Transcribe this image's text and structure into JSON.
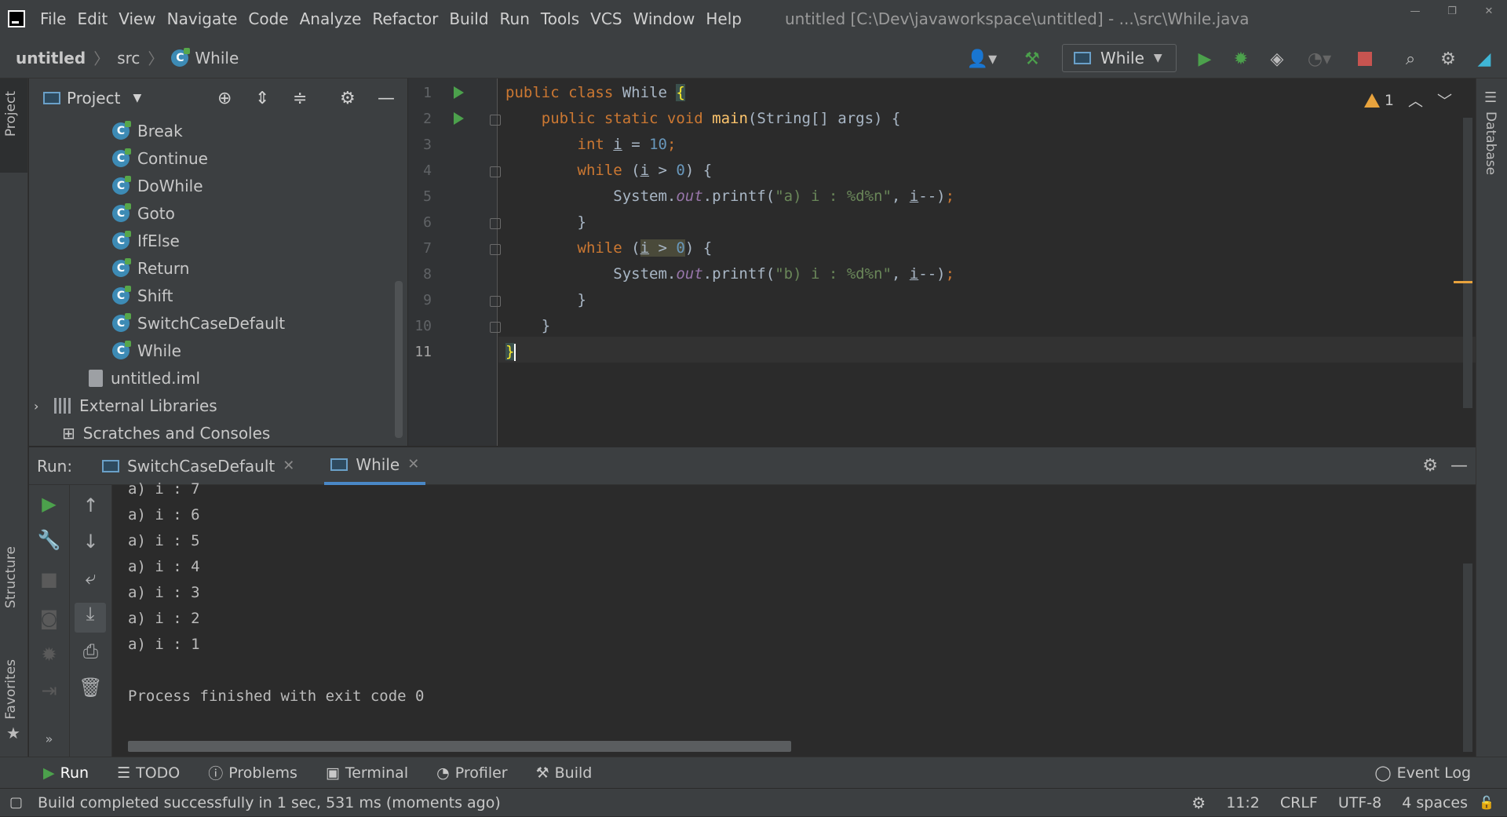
{
  "menubar": {
    "items": [
      "File",
      "Edit",
      "View",
      "Navigate",
      "Code",
      "Analyze",
      "Refactor",
      "Build",
      "Run",
      "Tools",
      "VCS",
      "Window",
      "Help"
    ],
    "window_title": "untitled [C:\\Dev\\javaworkspace\\untitled] - ...\\src\\While.java"
  },
  "breadcrumb": {
    "project": "untitled",
    "folder": "src",
    "file": "While"
  },
  "toolbar": {
    "run_config": "While"
  },
  "project_panel": {
    "title": "Project",
    "items": [
      "Break",
      "Continue",
      "DoWhile",
      "Goto",
      "IfElse",
      "Return",
      "Shift",
      "SwitchCaseDefault",
      "While"
    ],
    "iml": "untitled.iml",
    "external": "External Libraries",
    "scratches": "Scratches and Consoles"
  },
  "side_tabs": {
    "project": "Project",
    "structure": "Structure",
    "favorites": "Favorites",
    "database": "Database"
  },
  "editor": {
    "line_numbers": [
      "1",
      "2",
      "3",
      "4",
      "5",
      "6",
      "7",
      "8",
      "9",
      "10",
      "11"
    ],
    "warning_count": "1"
  },
  "run_panel": {
    "label": "Run:",
    "tabs": [
      "SwitchCaseDefault",
      "While"
    ]
  },
  "console": {
    "lines": [
      "a) i : 7",
      "a) i : 6",
      "a) i : 5",
      "a) i : 4",
      "a) i : 3",
      "a) i : 2",
      "a) i : 1",
      "",
      "Process finished with exit code 0"
    ]
  },
  "bottom_tabs": [
    "Run",
    "TODO",
    "Problems",
    "Terminal",
    "Profiler",
    "Build"
  ],
  "event_log": "Event Log",
  "status": {
    "message": "Build completed successfully in 1 sec, 531 ms (moments ago)",
    "position": "11:2",
    "line_sep": "CRLF",
    "encoding": "UTF-8",
    "indent": "4 spaces"
  },
  "colors": {
    "accent": "#4a88c7",
    "run_green": "#4ca14c",
    "stop_red": "#c75450",
    "warning": "#e8a33d"
  }
}
